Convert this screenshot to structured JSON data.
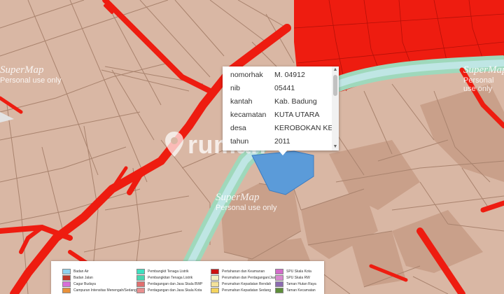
{
  "map": {
    "colors": {
      "lot": "#d9b7a4",
      "lot_dark": "#c99f87",
      "lot_line": "#a27d68",
      "road": "#ee1c10",
      "river": "#9fd8bb",
      "river_core": "#bfe6e4",
      "highlight_parcel": "#5b9bd9",
      "heritage": "#e9a8a2"
    },
    "watermarks": [
      {
        "brand": "SuperMap",
        "sub": "Personal use only"
      },
      {
        "brand": "SuperMap",
        "sub": "Personal use only"
      },
      {
        "brand": "SuperMap",
        "sub": "Personal use only"
      }
    ],
    "center_watermark": "rumah"
  },
  "popup": {
    "rows": [
      {
        "key": "nomorhak",
        "value": "M. 04912"
      },
      {
        "key": "nib",
        "value": "05441"
      },
      {
        "key": "kantah",
        "value": "Kab. Badung"
      },
      {
        "key": "kecamatan",
        "value": "KUTA UTARA"
      },
      {
        "key": "desa",
        "value": "KEROBOKAN KELOD"
      },
      {
        "key": "tahun",
        "value": "2011"
      }
    ]
  },
  "legend": {
    "items": [
      {
        "label": "Badan Air",
        "color": "#8fd3f0"
      },
      {
        "label": "Badan Jalan",
        "color": "#c0392b"
      },
      {
        "label": "Cagar Budaya",
        "color": "#d86fd8"
      },
      {
        "label": "Campuran Intensitas Menengah/Sedang",
        "color": "#e8913a"
      },
      {
        "label": "Pembangkit Tenaga Listrik",
        "color": "#3fe0c0"
      },
      {
        "label": "Pembangkitan Tenaga Listrik",
        "color": "#48d6b0"
      },
      {
        "label": "Perdagangan dan Jasa Skala BWP",
        "color": "#e07070"
      },
      {
        "label": "Perdagangan dan Jasa Skala Kota",
        "color": "#e89090"
      },
      {
        "label": "Pertahanan dan Keamanan",
        "color": "#cc1111"
      },
      {
        "label": "Perumahan dan Perdagangan/Jasa",
        "color": "#f3f0c0"
      },
      {
        "label": "Perumahan Kepadatan Rendah",
        "color": "#f3e29a"
      },
      {
        "label": "Perumahan Kepadatan Sedang",
        "color": "#f4d35e"
      },
      {
        "label": "SPU Skala Kota",
        "color": "#d26cc9"
      },
      {
        "label": "SPU Skala RW",
        "color": "#d98ad0"
      },
      {
        "label": "Taman Hutan Raya",
        "color": "#8c6bb1"
      },
      {
        "label": "Taman Kecamatan",
        "color": "#5e8e3a"
      }
    ]
  }
}
